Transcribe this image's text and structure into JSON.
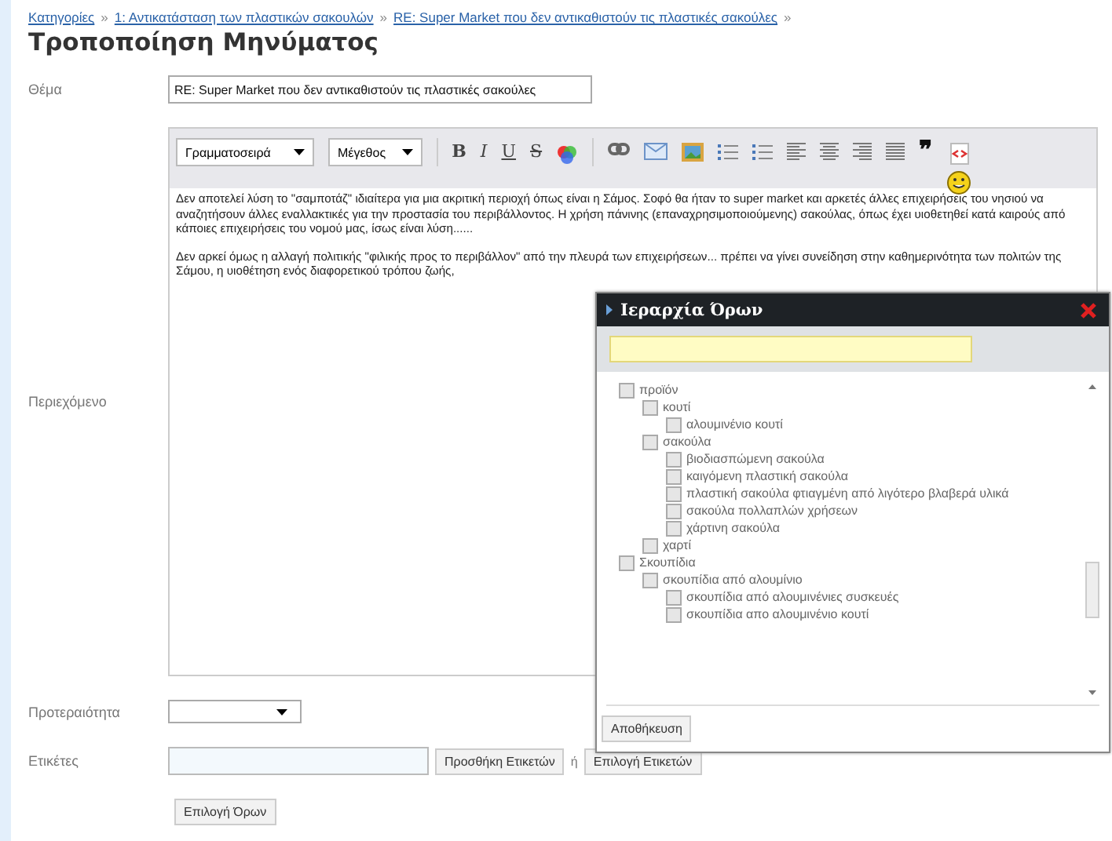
{
  "breadcrumb": [
    {
      "label": "Κατηγορίες"
    },
    {
      "label": "1: Αντικατάσταση των πλαστικών σακουλών"
    },
    {
      "label": "RE: Super Market που δεν αντικαθιστούν τις πλαστικές σακούλες"
    }
  ],
  "breadcrumb_separator": "»",
  "title": "Τροποποίηση Μηνύματος",
  "subject": {
    "label": "Θέμα",
    "value": "RE: Super Market που δεν αντικαθιστούν τις πλαστικές σακούλες"
  },
  "content": {
    "label": "Περιεχόμενο",
    "toolbar": [
      {
        "kind": "dropdown",
        "label": "Γραμματοσειρά"
      },
      {
        "kind": "dropdown",
        "label": "Μέγεθος"
      },
      {
        "kind": "sep"
      },
      {
        "kind": "bold",
        "label": "B"
      },
      {
        "kind": "italic",
        "label": "I"
      },
      {
        "kind": "underline",
        "label": "U"
      },
      {
        "kind": "strike",
        "label": "S"
      },
      {
        "kind": "color"
      },
      {
        "kind": "sep"
      },
      {
        "kind": "link"
      },
      {
        "kind": "email"
      },
      {
        "kind": "image"
      },
      {
        "kind": "olist"
      },
      {
        "kind": "ulist"
      },
      {
        "kind": "left"
      },
      {
        "kind": "center"
      },
      {
        "kind": "right"
      },
      {
        "kind": "justify"
      },
      {
        "kind": "quote",
        "label": "❞"
      },
      {
        "kind": "source"
      }
    ],
    "paragraphs": [
      "Δεν αποτελεί λύση το \"σαμποτάζ\" ιδιαίτερα για μια ακριτική περιοχή όπως είναι η Σάμος. Σοφό θα ήταν το super market και αρκετές άλλες επιχειρήσεις του νησιού να αναζητήσουν άλλες εναλλακτικές για την προστασία του περιβάλλοντος. Η χρήση πάνινης (επαναχρησιμοποιούμενης) σακούλας, όπως έχει υιοθετηθεί κατά καιρούς από κάποιες επιχειρήσεις του νομού μας, ίσως είναι λύση......",
      "Δεν αρκεί όμως η αλλαγή πολιτικής \"φιλικής προς το περιβάλλον\"  από την πλευρά των επιχειρήσεων... πρέπει να γίνει συνείδηση στην καθημερινότητα των πολιτών της Σάμου, η υιοθέτηση ενός διαφορετικού τρόπου ζωής,"
    ]
  },
  "priority": {
    "label": "Προτεραιότητα"
  },
  "tags": {
    "label": "Ετικέτες",
    "add_button": "Προσθήκη Ετικετών",
    "or": "ή",
    "choose_button": "Επιλογή Ετικετών"
  },
  "terms_button": "Επιλογή Όρων",
  "dialog": {
    "title": "Ιεραρχία Όρων",
    "save_button": "Αποθήκευση",
    "tree": [
      {
        "label": "προϊόν",
        "checked": false,
        "children": [
          {
            "label": "κουτί",
            "checked": false,
            "children": [
              {
                "label": "αλουμινένιο κουτί",
                "checked": false
              }
            ]
          },
          {
            "label": "σακούλα",
            "checked": false,
            "children": [
              {
                "label": "βιοδιασπώμενη σακούλα",
                "checked": false
              },
              {
                "label": "καιγόμενη πλαστική σακούλα",
                "checked": false
              },
              {
                "label": "πλαστική σακούλα φτιαγμένη από λιγότερο βλαβερά υλικά",
                "checked": false
              },
              {
                "label": "σακούλα πολλαπλών χρήσεων",
                "checked": false
              },
              {
                "label": "χάρτινη σακούλα",
                "checked": false
              }
            ]
          },
          {
            "label": "χαρτί",
            "checked": false
          }
        ]
      },
      {
        "label": "Σκουπίδια",
        "checked": false,
        "children": [
          {
            "label": "σκουπίδια από αλουμίνιο",
            "checked": false,
            "children": [
              {
                "label": "σκουπίδια από αλουμινένιες συσκευές",
                "checked": false
              },
              {
                "label": "σκουπίδια απο αλουμινένιο κουτί",
                "checked": false
              }
            ]
          }
        ]
      }
    ]
  }
}
